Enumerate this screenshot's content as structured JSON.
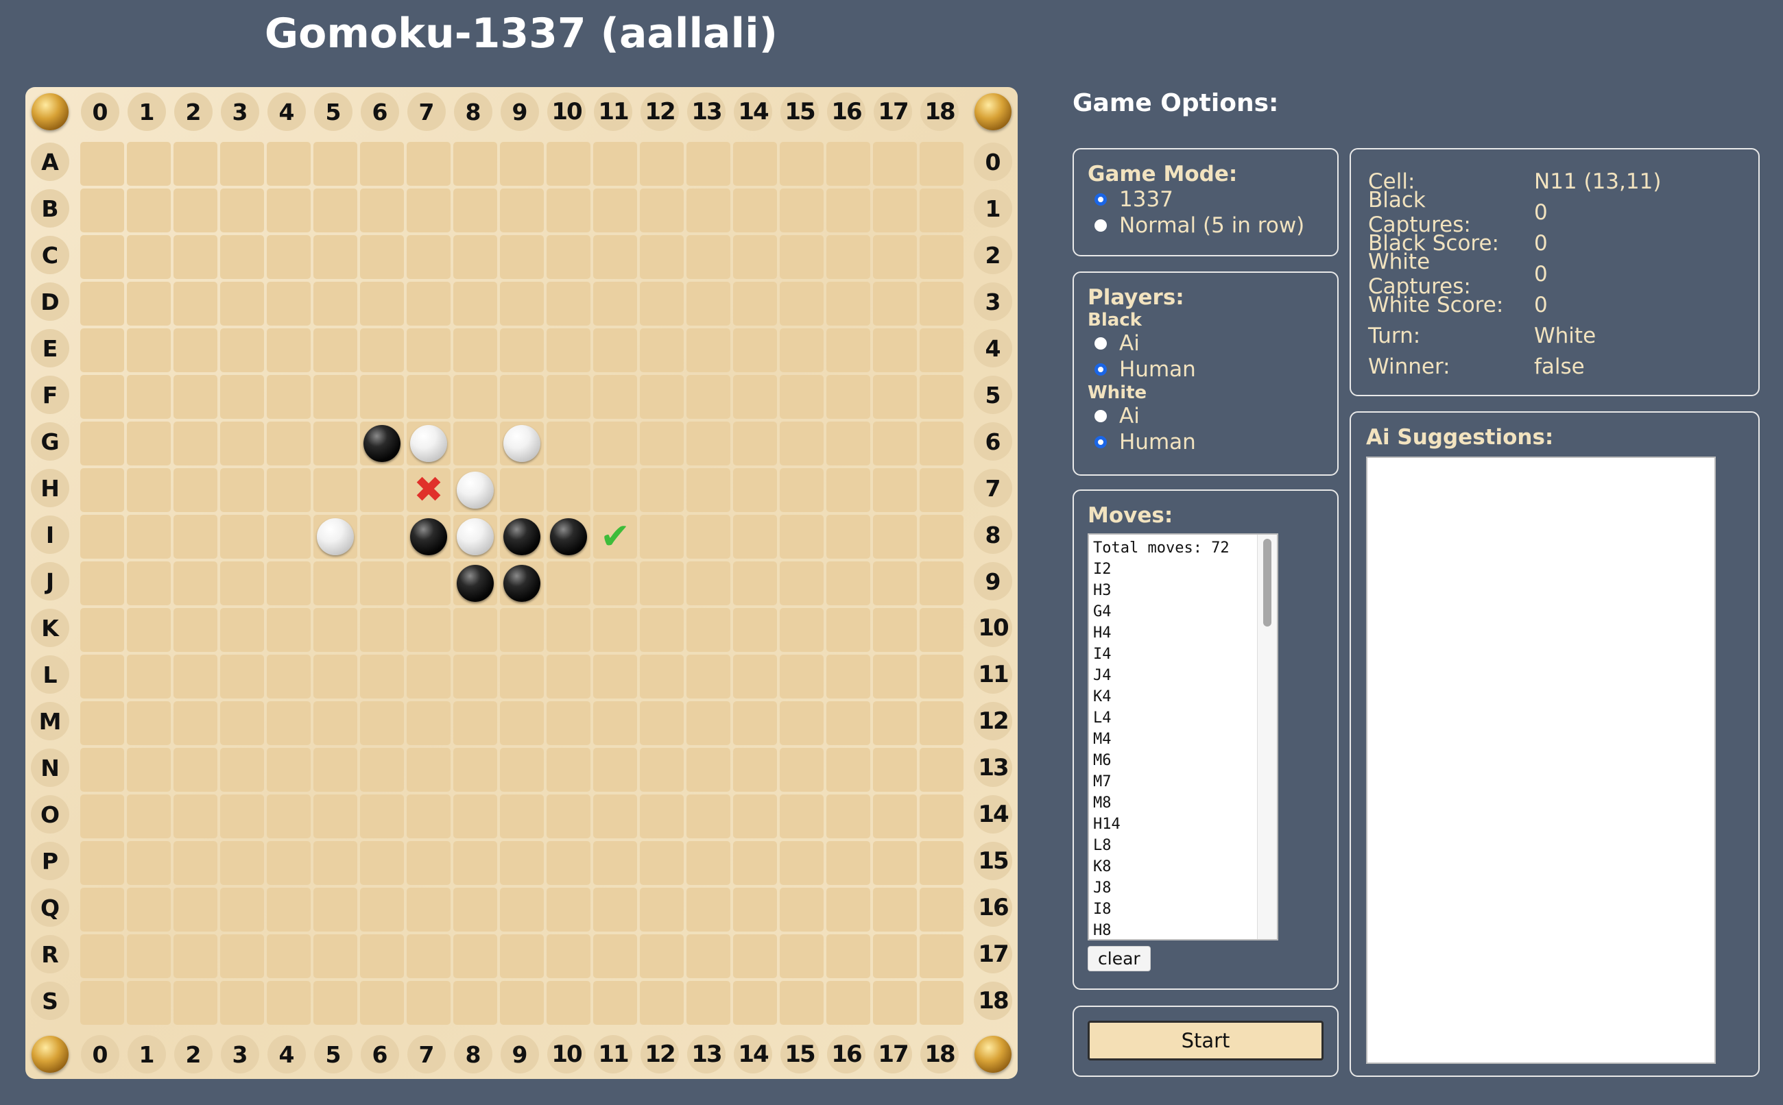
{
  "app": {
    "title": "Gomoku-1337 (aallali)"
  },
  "board": {
    "column_labels": [
      "0",
      "1",
      "2",
      "3",
      "4",
      "5",
      "6",
      "7",
      "8",
      "9",
      "10",
      "11",
      "12",
      "13",
      "14",
      "15",
      "16",
      "17",
      "18"
    ],
    "row_letters": [
      "A",
      "B",
      "C",
      "D",
      "E",
      "F",
      "G",
      "H",
      "I",
      "J",
      "K",
      "L",
      "M",
      "N",
      "O",
      "P",
      "Q",
      "R",
      "S"
    ],
    "row_numbers": [
      "0",
      "1",
      "2",
      "3",
      "4",
      "5",
      "6",
      "7",
      "8",
      "9",
      "10",
      "11",
      "12",
      "13",
      "14",
      "15",
      "16",
      "17",
      "18"
    ],
    "stones": [
      {
        "row": 6,
        "col": 6,
        "color": "black"
      },
      {
        "row": 6,
        "col": 7,
        "color": "white"
      },
      {
        "row": 6,
        "col": 9,
        "color": "white"
      },
      {
        "row": 7,
        "col": 8,
        "color": "white"
      },
      {
        "row": 8,
        "col": 5,
        "color": "white"
      },
      {
        "row": 8,
        "col": 7,
        "color": "black"
      },
      {
        "row": 8,
        "col": 8,
        "color": "white"
      },
      {
        "row": 8,
        "col": 9,
        "color": "black"
      },
      {
        "row": 8,
        "col": 10,
        "color": "black"
      },
      {
        "row": 9,
        "col": 8,
        "color": "black"
      },
      {
        "row": 9,
        "col": 9,
        "color": "black"
      }
    ],
    "markers": [
      {
        "row": 7,
        "col": 7,
        "type": "forbidden",
        "icon": "cross-icon",
        "glyph": "✖"
      },
      {
        "row": 8,
        "col": 11,
        "type": "suggested",
        "icon": "check-icon",
        "glyph": "✔"
      }
    ]
  },
  "options": {
    "title": "Game Options:",
    "game_mode": {
      "title": "Game Mode:",
      "options": [
        {
          "label": "1337",
          "selected": true
        },
        {
          "label": "Normal (5 in row)",
          "selected": false
        }
      ]
    },
    "players": {
      "title": "Players:",
      "black": {
        "label": "Black",
        "options": [
          {
            "label": "Ai",
            "selected": false
          },
          {
            "label": "Human",
            "selected": true
          }
        ]
      },
      "white": {
        "label": "White",
        "options": [
          {
            "label": "Ai",
            "selected": false
          },
          {
            "label": "Human",
            "selected": true
          }
        ]
      }
    },
    "moves": {
      "title": "Moves:",
      "lines": [
        "Total moves: 72",
        "I2",
        "H3",
        "G4",
        "H4",
        "I4",
        "J4",
        "K4",
        "L4",
        "M4",
        "M6",
        "M7",
        "M8",
        "H14",
        "L8",
        "K8",
        "J8",
        "I8",
        "H8"
      ],
      "clear_label": "clear"
    },
    "start_label": "Start"
  },
  "info": {
    "cell_label": "Cell:",
    "cell_value": "N11 (13,11)",
    "black_captures_label": "Black Captures:",
    "black_captures_value": "0",
    "black_score_label": "Black Score:",
    "black_score_value": "0",
    "white_captures_label": "White Captures:",
    "white_captures_value": "0",
    "white_score_label": "White Score:",
    "white_score_value": "0",
    "turn_label": "Turn:",
    "turn_value": "White",
    "winner_label": "Winner:",
    "winner_value": "false"
  },
  "ai_suggestions": {
    "title": "Ai Suggestions:",
    "text": ""
  },
  "colors": {
    "background": "#4f5c6f",
    "panel_text": "#f2e3bf",
    "board": "#efdcb6",
    "cell": "#ead0a1",
    "radio_accent": "#1b66e6",
    "forbidden_mark": "#e0302a",
    "suggest_mark": "#3ebc3a"
  }
}
